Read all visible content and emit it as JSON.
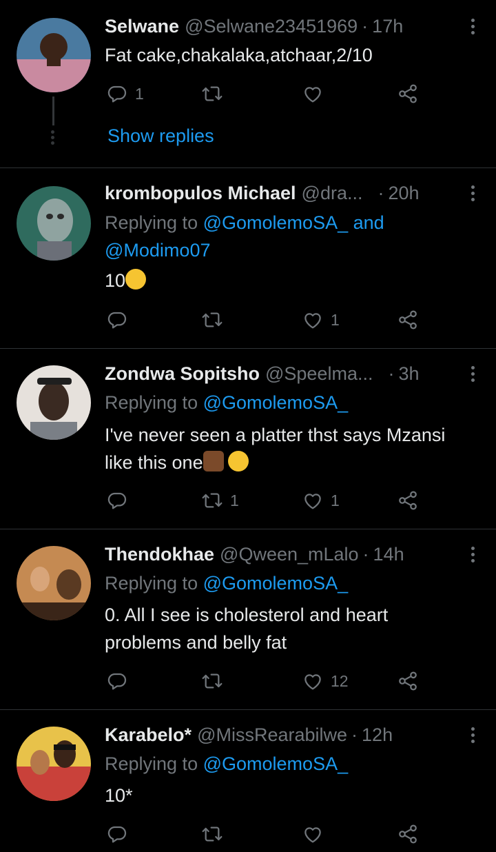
{
  "tweets": [
    {
      "name": "Selwane",
      "handle": "@Selwane23451969",
      "time": "17h",
      "lines": [
        "Fat cake,chakalaka,atchaar,2/10"
      ],
      "replies": "1",
      "retweets": "",
      "likes": "",
      "show_replies": "Show replies",
      "avatar_colors": [
        "#4a7aa0",
        "#c98aa0"
      ]
    },
    {
      "name": "krombopulos Michael",
      "handle": "@dra...",
      "time": "20h",
      "replying_prefix": "Replying to",
      "replying_to": "@GomolemoSA_",
      "replying_and": "and",
      "replying_to_2": "@Modimo07",
      "text": "10",
      "replies": "",
      "retweets": "",
      "likes": "1",
      "avatar_colors": [
        "#2f6b5e",
        "#8fa3a0"
      ]
    },
    {
      "name": "Zondwa Sopitsho",
      "handle": "@Speelma...",
      "time": "3h",
      "replying_prefix": "Replying to",
      "replying_to": "@GomolemoSA_",
      "lines": [
        "I've never seen a platter thst says Mzansi",
        "like this one"
      ],
      "replies": "",
      "retweets": "1",
      "likes": "1",
      "avatar_colors": [
        "#e6e1dc",
        "#3a2a22"
      ]
    },
    {
      "name": "Thendokhae",
      "handle": "@Qween_mLalo",
      "time": "14h",
      "replying_prefix": "Replying to",
      "replying_to": "@GomolemoSA_",
      "lines": [
        "0. All I see is cholesterol and heart",
        "problems and belly fat"
      ],
      "replies": "",
      "retweets": "",
      "likes": "12",
      "avatar_colors": [
        "#c58a52",
        "#5a3a22"
      ]
    },
    {
      "name": "Karabelo*",
      "handle": "@MissRearabilwe",
      "time": "12h",
      "replying_prefix": "Replying to",
      "replying_to": "@GomolemoSA_",
      "lines": [
        "10*"
      ],
      "replies": "",
      "retweets": "",
      "likes": "",
      "avatar_colors": [
        "#c9413a",
        "#e8c24a"
      ]
    }
  ],
  "icons": {
    "reply": "reply-icon",
    "retweet": "retweet-icon",
    "like": "heart-icon",
    "share": "share-icon",
    "more": "more-options-icon"
  },
  "colors": {
    "link": "#1d9bf0",
    "muted": "#71767b",
    "background": "#000000"
  }
}
